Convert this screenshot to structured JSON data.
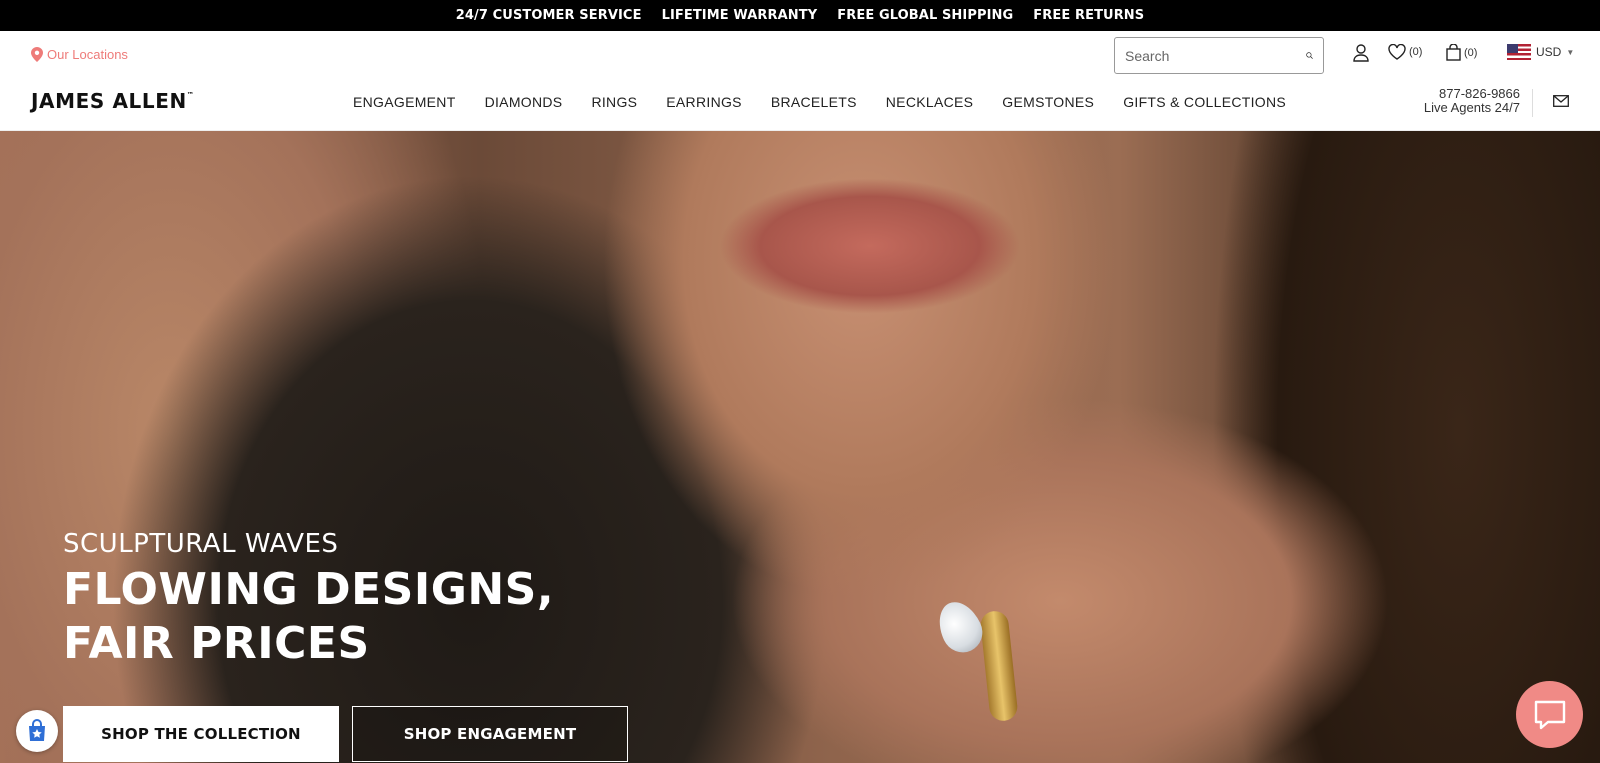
{
  "promo_bar": {
    "items": [
      "24/7 CUSTOMER SERVICE",
      "LIFETIME WARRANTY",
      "FREE GLOBAL SHIPPING",
      "FREE RETURNS"
    ]
  },
  "utility": {
    "locations_label": "Our Locations",
    "search_placeholder": "Search",
    "wishlist_count": "(0)",
    "cart_count": "(0)",
    "currency": "USD"
  },
  "header": {
    "logo": "JAMES ALLEN",
    "logo_mark": "™",
    "nav": [
      "ENGAGEMENT",
      "DIAMONDS",
      "RINGS",
      "EARRINGS",
      "BRACELETS",
      "NECKLACES",
      "GEMSTONES",
      "GIFTS & COLLECTIONS"
    ],
    "phone": "877-826-9866",
    "phone_note": "Live Agents 24/7"
  },
  "hero": {
    "eyebrow": "SCULPTURAL WAVES",
    "headline_line1": "FLOWING DESIGNS,",
    "headline_line2": "FAIR PRICES",
    "cta_primary": "SHOP THE COLLECTION",
    "cta_secondary": "SHOP ENGAGEMENT"
  },
  "icons": {
    "location": "map-pin-icon",
    "search": "search-icon",
    "account": "user-icon",
    "wishlist": "heart-icon",
    "cart": "shopping-bag-icon",
    "flag": "us-flag-icon",
    "mail": "mail-icon",
    "chat": "chat-icon"
  },
  "colors": {
    "accent": "#ee7b79",
    "chat_bg": "#f08a86",
    "promo_bg": "#000000"
  }
}
